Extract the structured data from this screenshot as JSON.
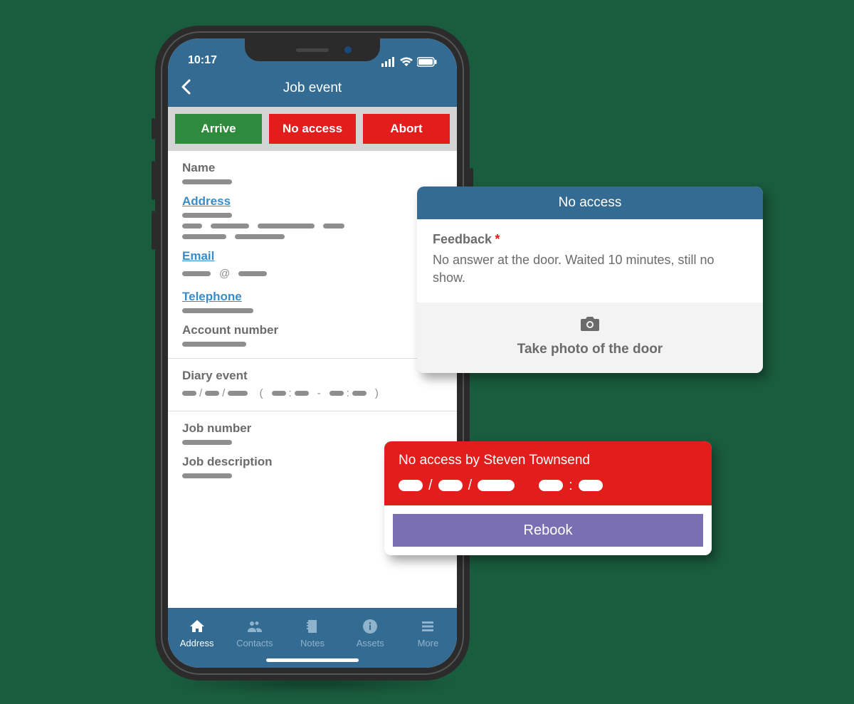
{
  "status": {
    "time": "10:17"
  },
  "nav": {
    "title": "Job event"
  },
  "actions": {
    "arrive": "Arrive",
    "noaccess": "No access",
    "abort": "Abort"
  },
  "fields": {
    "name": "Name",
    "address": "Address",
    "email": "Email",
    "telephone": "Telephone",
    "account_number": "Account number",
    "diary_event": "Diary event",
    "job_number": "Job number",
    "job_description": "Job description"
  },
  "tabs": {
    "address": "Address",
    "contacts": "Contacts",
    "notes": "Notes",
    "assets": "Assets",
    "more": "More"
  },
  "popup1": {
    "title": "No access",
    "feedback_label": "Feedback",
    "required_mark": "*",
    "feedback_text": "No answer at the door. Waited 10 minutes, still no show.",
    "photo_label": "Take photo of the door"
  },
  "popup2": {
    "line1": "No access by Steven Townsend",
    "rebook": "Rebook"
  }
}
